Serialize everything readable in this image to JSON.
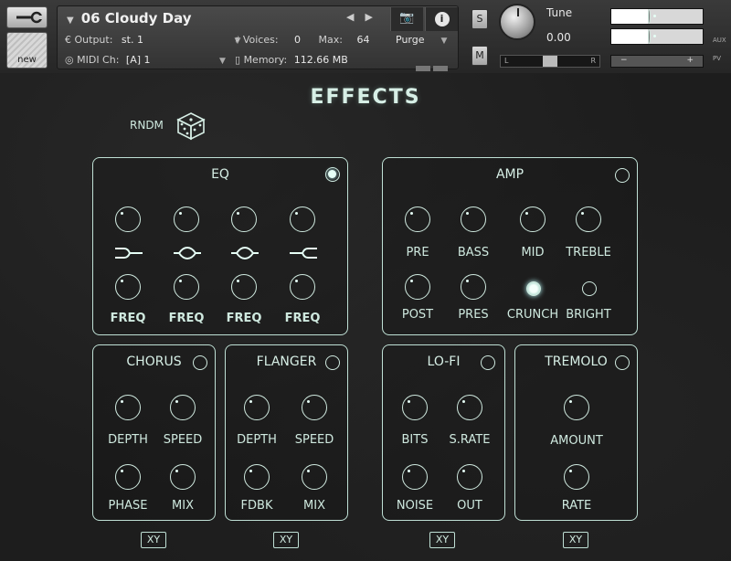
{
  "header": {
    "instrument_name": "06 Cloudy Day",
    "output_label": "Output:",
    "output_value": "st. 1",
    "voices_label": "Voices:",
    "voices_value": "0",
    "max_label": "Max:",
    "max_value": "64",
    "midi_label": "MIDI Ch:",
    "midi_value": "[A]  1",
    "memory_label": "Memory:",
    "memory_value": "112.66 MB",
    "purge_label": "Purge",
    "new_label": "new",
    "solo_label": "S",
    "mute_label": "M",
    "tune_label": "Tune",
    "tune_value": "0.00",
    "pan_left": "L",
    "pan_right": "R",
    "aux_label": "AUX",
    "pv_label": "PV",
    "minus": "−",
    "plus": "+"
  },
  "page": {
    "title": "EFFECTS",
    "rndm_label": "RNDM"
  },
  "eq": {
    "title": "EQ",
    "enabled": true,
    "freq_labels": [
      "FREQ",
      "FREQ",
      "FREQ",
      "FREQ"
    ]
  },
  "amp": {
    "title": "AMP",
    "enabled": false,
    "row1": [
      "PRE",
      "BASS",
      "MID",
      "TREBLE"
    ],
    "row2": [
      "POST",
      "PRES",
      "CRUNCH",
      "BRIGHT"
    ],
    "crunch_on": true,
    "bright_on": false
  },
  "chorus": {
    "title": "CHORUS",
    "enabled": false,
    "labels": [
      "DEPTH",
      "SPEED",
      "PHASE",
      "MIX"
    ]
  },
  "flanger": {
    "title": "FLANGER",
    "enabled": false,
    "labels": [
      "DEPTH",
      "SPEED",
      "FDBK",
      "MIX"
    ]
  },
  "lofi": {
    "title": "LO-FI",
    "enabled": false,
    "labels": [
      "BITS",
      "S.RATE",
      "NOISE",
      "OUT"
    ]
  },
  "tremolo": {
    "title": "TREMOLO",
    "enabled": false,
    "labels": [
      "AMOUNT",
      "RATE"
    ]
  },
  "xy_label": "XY",
  "colors": {
    "accent": "#cfe9df",
    "background": "#1d1d1d"
  },
  "icons": [
    "wrench-icon",
    "camera-icon",
    "info-icon",
    "dice-icon",
    "eq-low-shelf-icon",
    "eq-peak-icon",
    "eq-high-shelf-icon"
  ]
}
